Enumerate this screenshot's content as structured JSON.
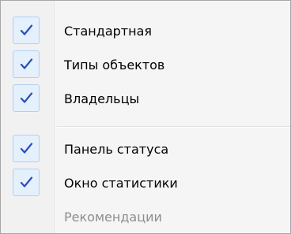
{
  "menu": {
    "items": [
      {
        "label": "Стандартная",
        "checked": true,
        "enabled": true
      },
      {
        "label": "Типы объектов",
        "checked": true,
        "enabled": true
      },
      {
        "label": "Владельцы",
        "checked": true,
        "enabled": true
      },
      {
        "label": "Панель статуса",
        "checked": true,
        "enabled": true
      },
      {
        "label": "Окно статистики",
        "checked": true,
        "enabled": true
      },
      {
        "label": "Рекомендации",
        "checked": false,
        "enabled": false
      }
    ]
  },
  "colors": {
    "check_mark": "#2a50b8",
    "check_box_fill": "#e5f0fd",
    "check_box_border": "#aecff7",
    "disabled_text": "#8d8d8d"
  },
  "icons": {
    "check": "checkmark-icon"
  }
}
